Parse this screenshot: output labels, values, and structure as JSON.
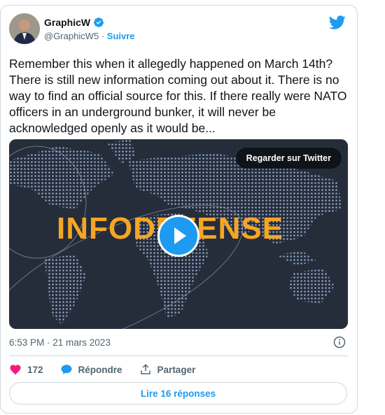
{
  "author": {
    "name": "GraphicW",
    "handle": "@GraphicW5",
    "separator": " · ",
    "follow_label": "Suivre"
  },
  "tweet_text": "Remember this when it allegedly happened on March 14th?  There is still new information coming out about it.  There is no way to find an official source for this.  If there really were NATO officers in an underground bunker, it will never be acknowledged openly as it would be...",
  "media": {
    "watch_label": "Regarder sur Twitter",
    "logo_text": "INFODEFENSE"
  },
  "timestamp": "6:53 PM · 21 mars 2023",
  "actions": {
    "likes": "172",
    "reply_label": "Répondre",
    "share_label": "Partager"
  },
  "replies_button_label": "Lire 16 réponses",
  "colors": {
    "accent": "#1d9bf0",
    "like": "#f91880",
    "logo": "#f5a623",
    "media_bg": "#262d3a"
  }
}
